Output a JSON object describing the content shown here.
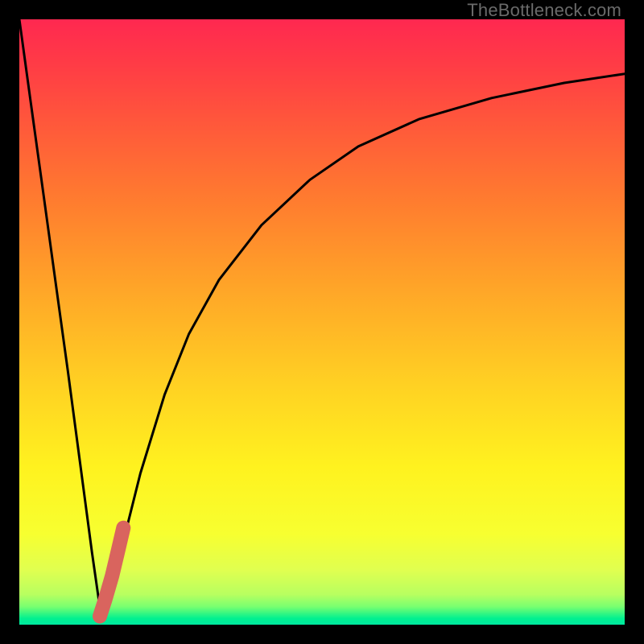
{
  "watermark": {
    "text": "TheBottleneck.com"
  },
  "colors": {
    "curve_stroke": "#000000",
    "marker_stroke": "#d9645e",
    "marker_fill": "#d9645e"
  },
  "chart_data": {
    "type": "line",
    "title": "",
    "xlabel": "",
    "ylabel": "",
    "xlim": [
      0,
      100
    ],
    "ylim": [
      0,
      100
    ],
    "grid": false,
    "legend": false,
    "series": [
      {
        "name": "bottleneck-curve",
        "x": [
          0,
          2,
          4,
          6,
          8,
          10,
          12,
          13.5,
          15,
          17,
          20,
          24,
          28,
          33,
          40,
          48,
          56,
          66,
          78,
          90,
          100
        ],
        "y": [
          100,
          85.5,
          71,
          56.5,
          42,
          27,
          12,
          1.5,
          4,
          13,
          25,
          38,
          48,
          57,
          66,
          73.5,
          79,
          83.5,
          87,
          89.5,
          91
        ]
      },
      {
        "name": "highlight-segment",
        "x": [
          13.3,
          14.2,
          15.3,
          16.3,
          17.2
        ],
        "y": [
          1.4,
          4.2,
          8.0,
          12.2,
          16.0
        ]
      }
    ],
    "annotations": [
      {
        "text": "TheBottleneck.com",
        "position": "top-right"
      }
    ]
  }
}
